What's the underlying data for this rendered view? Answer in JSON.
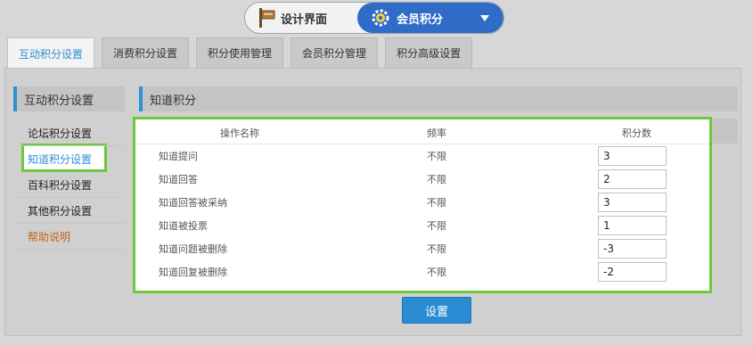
{
  "switcher": {
    "design_label": "设计界面",
    "member_label": "会员积分",
    "design_icon": "signboard-icon",
    "member_icon": "gear-icon",
    "accent": "#2f6cc8"
  },
  "tabs": [
    {
      "label": "互动积分设置"
    },
    {
      "label": "消费积分设置"
    },
    {
      "label": "积分使用管理"
    },
    {
      "label": "会员积分管理"
    },
    {
      "label": "积分高级设置"
    }
  ],
  "sidebar": {
    "title": "互动积分设置",
    "items": [
      {
        "label": "论坛积分设置"
      },
      {
        "label": "知道积分设置"
      },
      {
        "label": "百科积分设置"
      },
      {
        "label": "其他积分设置"
      },
      {
        "label": "帮助说明"
      }
    ]
  },
  "main": {
    "title": "知道积分",
    "columns": {
      "name": "操作名称",
      "freq": "频率",
      "score": "积分数"
    },
    "rows": [
      {
        "name": "知道提问",
        "freq": "不限",
        "score": "3"
      },
      {
        "name": "知道回答",
        "freq": "不限",
        "score": "2"
      },
      {
        "name": "知道回答被采纳",
        "freq": "不限",
        "score": "3"
      },
      {
        "name": "知道被投票",
        "freq": "不限",
        "score": "1"
      },
      {
        "name": "知道问题被删除",
        "freq": "不限",
        "score": "-3"
      },
      {
        "name": "知道回复被删除",
        "freq": "不限",
        "score": "-2"
      }
    ],
    "submit_label": "设置"
  },
  "colors": {
    "highlight": "#6dc93b",
    "button": "#2a8bd2",
    "help": "#c0641a"
  }
}
